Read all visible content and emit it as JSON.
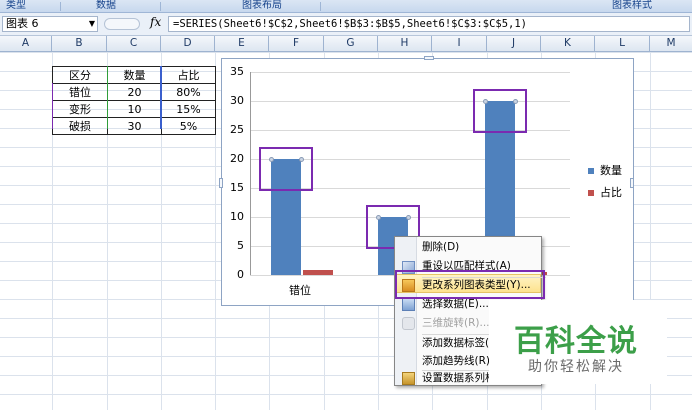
{
  "ribbon": {
    "groups": [
      "类型",
      "数据",
      "图表布局",
      "图表样式"
    ]
  },
  "formula_bar": {
    "name_box": "图表 6",
    "fx": "fx",
    "formula": "=SERIES(Sheet6!$C$2,Sheet6!$B$3:$B$5,Sheet6!$C$3:$C$5,1)"
  },
  "columns": [
    "A",
    "B",
    "C",
    "D",
    "E",
    "F",
    "G",
    "H",
    "I",
    "J",
    "K",
    "L",
    "M"
  ],
  "table": {
    "headers": [
      "区分",
      "数量",
      "占比"
    ],
    "rows": [
      [
        "错位",
        "20",
        "80%"
      ],
      [
        "变形",
        "10",
        "15%"
      ],
      [
        "破损",
        "30",
        "5%"
      ]
    ]
  },
  "chart_data": {
    "type": "bar",
    "categories": [
      "错位",
      "变形",
      "破损"
    ],
    "series": [
      {
        "name": "数量",
        "values": [
          20,
          10,
          30
        ],
        "color": "#4f81bd"
      },
      {
        "name": "占比",
        "values": [
          0.8,
          0.15,
          0.05
        ],
        "color": "#c0504d"
      }
    ],
    "ylim": [
      0,
      35
    ],
    "yticks": [
      "35",
      "30",
      "25",
      "20",
      "15",
      "10",
      "5",
      "0"
    ],
    "visible_category_labels": [
      "错位"
    ],
    "legend": "right"
  },
  "context_menu": {
    "items": [
      {
        "label": "删除(D)",
        "enabled": true
      },
      {
        "label": "重设以匹配样式(A)",
        "enabled": true
      },
      {
        "label": "更改系列图表类型(Y)...",
        "enabled": true,
        "highlighted": true
      },
      {
        "label": "选择数据(E)...",
        "enabled": true
      },
      {
        "label": "三维旋转(R)...",
        "enabled": false
      },
      {
        "label": "添加数据标签(B)",
        "enabled": true
      },
      {
        "label": "添加趋势线(R)...",
        "enabled": true
      },
      {
        "label": "设置数据系列格式",
        "enabled": true
      }
    ]
  },
  "watermark": {
    "title": "百科全说",
    "subtitle": "助你轻松解决"
  },
  "colors": {
    "highlight_box": "#7b2ab0",
    "series1": "#4f81bd",
    "series2": "#c0504d"
  }
}
